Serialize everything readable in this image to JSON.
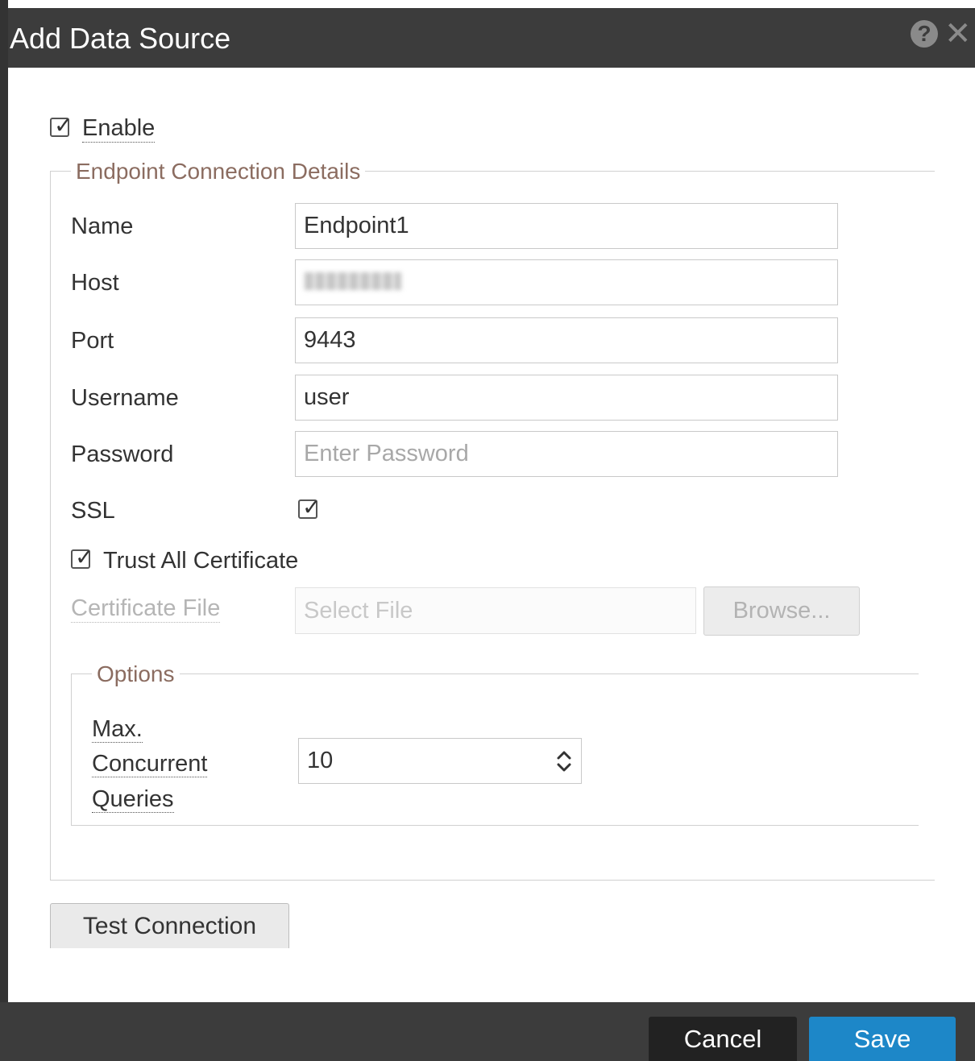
{
  "dialog": {
    "title": "Add Data Source",
    "help_icon": "question-circle-icon",
    "close_icon": "close-icon"
  },
  "enable": {
    "label": "Enable",
    "checked": true
  },
  "endpoint_section": {
    "legend": "Endpoint Connection Details",
    "fields": {
      "name": {
        "label": "Name",
        "value": "Endpoint1"
      },
      "host": {
        "label": "Host",
        "value": ""
      },
      "port": {
        "label": "Port",
        "value": "9443"
      },
      "username": {
        "label": "Username",
        "value": "user"
      },
      "password": {
        "label": "Password",
        "value": "",
        "placeholder": "Enter Password"
      }
    },
    "ssl": {
      "label": "SSL",
      "checked": true
    },
    "trust_all": {
      "label": "Trust All Certificate",
      "checked": true
    },
    "certificate": {
      "label": "Certificate File",
      "placeholder": "Select File",
      "browse_label": "Browse..."
    }
  },
  "options_section": {
    "legend": "Options",
    "max_concurrent": {
      "label_line1": "Max.",
      "label_line2": "Concurrent",
      "label_line3": "Queries",
      "value": "10"
    }
  },
  "test_connection_label": "Test Connection",
  "footer": {
    "cancel_label": "Cancel",
    "save_label": "Save"
  },
  "colors": {
    "header_bg": "#3c3c3c",
    "save_bg": "#1d87c8",
    "cancel_bg": "#222222",
    "legend_text": "#8b6c60"
  }
}
